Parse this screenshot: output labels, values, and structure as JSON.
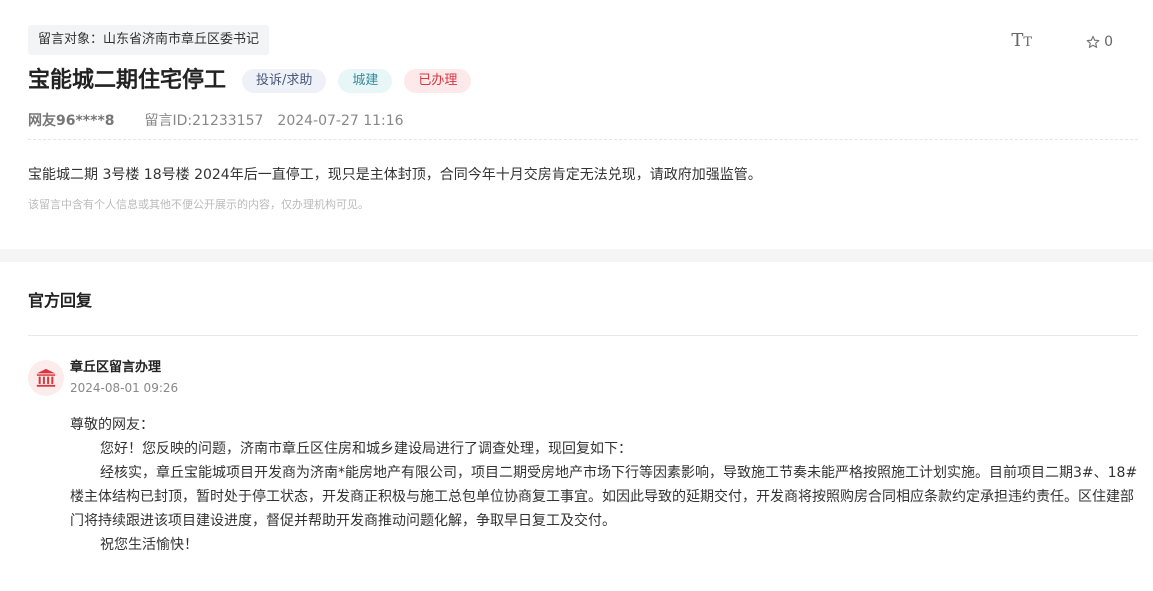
{
  "message": {
    "target": "留言对象：山东省济南市章丘区委书记",
    "title": "宝能城二期住宅停工",
    "tags": {
      "type": "投诉/求助",
      "field": "城建",
      "status": "已办理"
    },
    "user": "网友96****8",
    "id": "留言ID:21233157",
    "time": "2024-07-27 11:16",
    "content": "宝能城二期 3号楼 18号楼 2024年后一直停工，现只是主体封顶，合同今年十月交房肯定无法兑现，请政府加强监管。",
    "privacy_note": "该留言中含有个人信息或其他不便公开展示的内容，仅办理机构可见。"
  },
  "tools": {
    "font_icon_big": "T",
    "font_icon_small": "T",
    "star_count": "0"
  },
  "reply": {
    "section_title": "官方回复",
    "department": "章丘区留言办理",
    "time": "2024-08-01 09:26",
    "greeting": "尊敬的网友：",
    "p1": "您好！您反映的问题，济南市章丘区住房和城乡建设局进行了调查处理，现回复如下：",
    "p2": "经核实，章丘宝能城项目开发商为济南*能房地产有限公司，项目二期受房地产市场下行等因素影响，导致施工节奏未能严格按照施工计划实施。目前项目二期3#、18#楼主体结构已封顶，暂时处于停工状态，开发商正积极与施工总包单位协商复工事宜。如因此导致的延期交付，开发商将按照购房合同相应条款约定承担违约责任。区住建部门将持续跟进该项目建设进度，督促并帮助开发商推动问题化解，争取早日复工及交付。",
    "closing": "祝您生活愉快！"
  },
  "colors": {
    "status_red": "#d9363e",
    "field_teal": "#3a8b9c",
    "type_slate": "#4a5a7a"
  }
}
